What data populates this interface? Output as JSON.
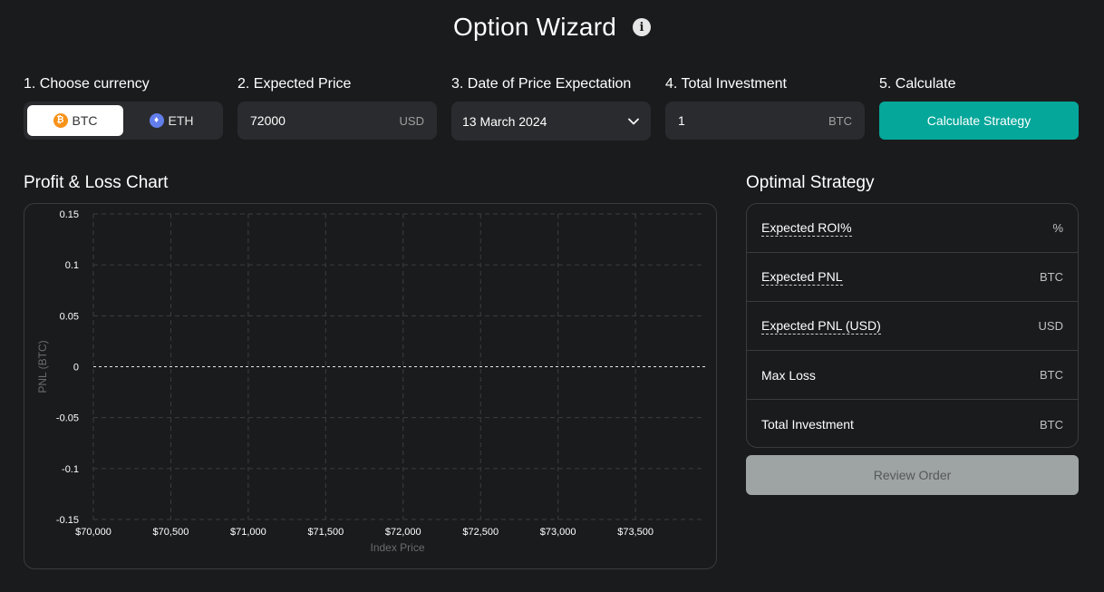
{
  "header": {
    "title": "Option Wizard",
    "info_icon": "info-icon"
  },
  "steps": {
    "currency": {
      "label": "1. Choose currency",
      "options": [
        {
          "label": "BTC",
          "icon": "btc-coin-icon",
          "selected": true
        },
        {
          "label": "ETH",
          "icon": "eth-coin-icon",
          "selected": false
        }
      ]
    },
    "price": {
      "label": "2. Expected Price",
      "value": "72000",
      "unit": "USD"
    },
    "date": {
      "label": "3. Date of Price Expectation",
      "value": "13 March 2024"
    },
    "investment": {
      "label": "4. Total Investment",
      "value": "1",
      "unit": "BTC"
    },
    "calculate": {
      "label": "5. Calculate",
      "button_label": "Calculate Strategy"
    }
  },
  "pnl_section": {
    "title": "Profit & Loss Chart"
  },
  "strategy": {
    "title": "Optimal Strategy",
    "rows": [
      {
        "label": "Expected ROI%",
        "unit": "%",
        "tooltip": true
      },
      {
        "label": "Expected PNL",
        "unit": "BTC",
        "tooltip": true
      },
      {
        "label": "Expected PNL (USD)",
        "unit": "USD",
        "tooltip": true
      },
      {
        "label": "Max Loss",
        "unit": "BTC",
        "tooltip": false
      },
      {
        "label": "Total Investment",
        "unit": "BTC",
        "tooltip": false
      }
    ],
    "review_button": "Review Order"
  },
  "colors": {
    "background": "#1a1b1d",
    "panel": "#2a2b2e",
    "accent": "#05a79a",
    "disabled_button": "#9ea3a4",
    "btc": "#f7931a",
    "eth": "#627eea"
  },
  "chart_data": {
    "type": "line",
    "title": "",
    "xlabel": "Index Price",
    "ylabel": "PNL (BTC)",
    "x_ticks": [
      "$70,000",
      "$70,500",
      "$71,000",
      "$71,500",
      "$72,000",
      "$72,500",
      "$73,000",
      "$73,500"
    ],
    "x_tick_values": [
      70000,
      70500,
      71000,
      71500,
      72000,
      72500,
      73000,
      73500
    ],
    "xlim": [
      70000,
      73950
    ],
    "y_ticks": [
      "0.15",
      "0.1",
      "0.05",
      "0",
      "-0.05",
      "-0.1",
      "-0.15"
    ],
    "y_tick_values": [
      0.15,
      0.1,
      0.05,
      0,
      -0.05,
      -0.1,
      -0.15
    ],
    "ylim": [
      -0.15,
      0.15
    ],
    "grid": true,
    "series": []
  }
}
